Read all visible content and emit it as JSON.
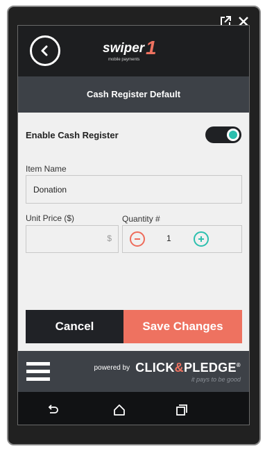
{
  "header": {
    "logo_text": "swiper",
    "logo_number": "1",
    "logo_tagline": "mobile payments"
  },
  "subheader": {
    "title": "Cash Register Default"
  },
  "settings": {
    "enable_label": "Enable Cash Register",
    "enabled": true
  },
  "form": {
    "item_name_label": "Item Name",
    "item_name_value": "Donation",
    "unit_price_label": "Unit Price ($)",
    "unit_price_value": "",
    "unit_price_suffix": "$",
    "quantity_label": "Quantity #",
    "quantity_value": "1"
  },
  "actions": {
    "cancel_label": "Cancel",
    "save_label": "Save Changes"
  },
  "footer": {
    "powered_by": "powered by",
    "brand_part1": "CLICK",
    "brand_amp": "&",
    "brand_part2": "PLEDGE",
    "brand_reg": "®",
    "tagline": "it pays to be good"
  },
  "colors": {
    "accent_teal": "#2bbfae",
    "accent_coral": "#ee7260",
    "dark": "#1d1e20",
    "bar_gray": "#3d4147"
  },
  "icons": {
    "window": [
      "external-link-icon",
      "close-icon"
    ],
    "nav": [
      "back-icon",
      "home-icon",
      "recent-apps-icon"
    ]
  }
}
